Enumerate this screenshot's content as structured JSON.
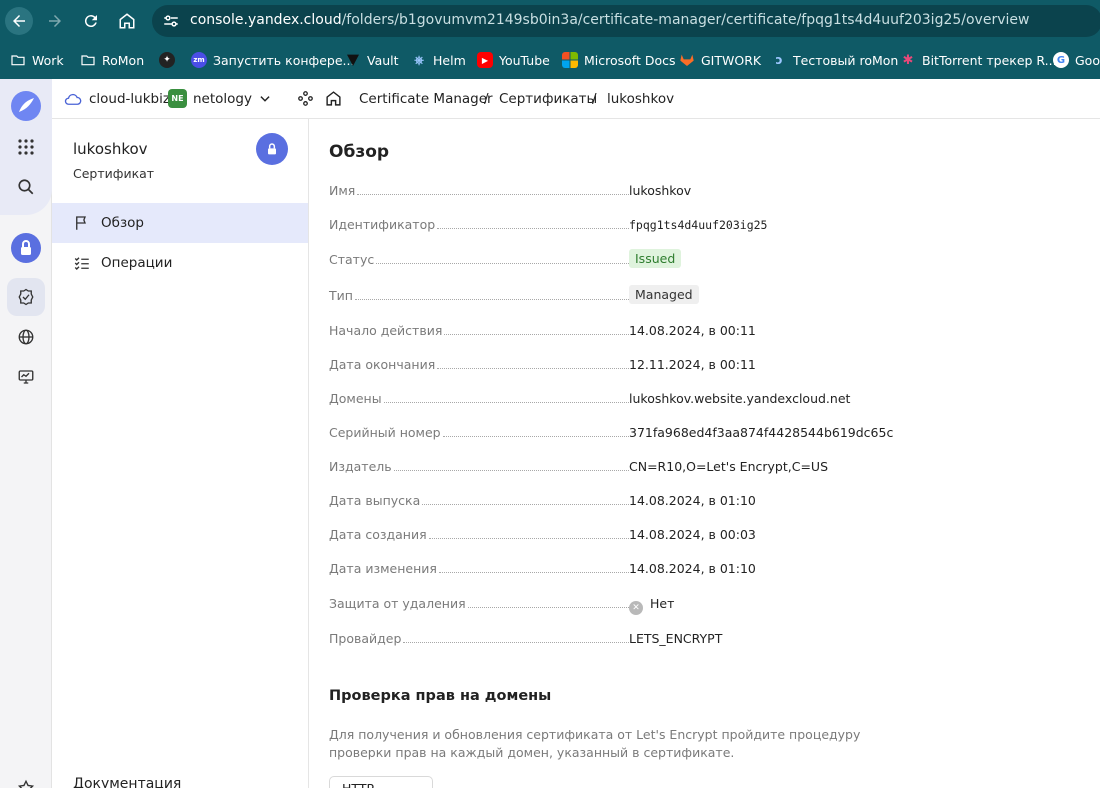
{
  "browser": {
    "url_host": "console.yandex.cloud",
    "url_path": "/folders/b1govumvm2149sb0in3a/certificate-manager/certificate/fpqg1ts4d4uuf203ig25/overview",
    "bookmarks": [
      {
        "label": "Work",
        "icon": "folder-icon"
      },
      {
        "label": "RoMon",
        "icon": "folder-icon"
      },
      {
        "label": "",
        "icon": "plus-star-icon"
      },
      {
        "label": "Запустить конфере...",
        "icon": "zoom-icon"
      },
      {
        "label": "Vault",
        "icon": "vault-icon"
      },
      {
        "label": "Helm",
        "icon": "helm-icon"
      },
      {
        "label": "YouTube",
        "icon": "youtube-icon"
      },
      {
        "label": "Microsoft Docs",
        "icon": "microsoft-icon"
      },
      {
        "label": "GITWORK",
        "icon": "gitlab-icon"
      },
      {
        "label": "Тестовый roMon",
        "icon": "romon-icon"
      },
      {
        "label": "BitTorrent трекер R...",
        "icon": "rutracker-icon"
      },
      {
        "label": "Google",
        "icon": "google-icon"
      }
    ]
  },
  "topbar": {
    "cloud": "cloud-lukbiz",
    "folder_badge": "NE",
    "folder": "netology",
    "breadcrumb": [
      "Certificate Manager",
      "Сертификаты",
      "lukoshkov"
    ],
    "separator": "/"
  },
  "sidebar": {
    "title": "lukoshkov",
    "subtitle": "Сертификат",
    "items": [
      {
        "label": "Обзор",
        "active": true
      },
      {
        "label": "Операции",
        "active": false
      }
    ],
    "docs": "Документация"
  },
  "main": {
    "heading": "Обзор",
    "fields": [
      {
        "label": "Имя",
        "value": "lukoshkov"
      },
      {
        "label": "Идентификатор",
        "value": "fpqg1ts4d4uuf203ig25"
      },
      {
        "label": "Статус",
        "value": "Issued"
      },
      {
        "label": "Тип",
        "value": "Managed"
      },
      {
        "label": "Начало действия",
        "value": "14.08.2024, в 00:11"
      },
      {
        "label": "Дата окончания",
        "value": "12.11.2024, в 00:11"
      },
      {
        "label": "Домены",
        "value": "lukoshkov.website.yandexcloud.net"
      },
      {
        "label": "Серийный номер",
        "value": "371fa968ed4f3aa874f4428544b619dc65c"
      },
      {
        "label": "Издатель",
        "value": "CN=R10,O=Let's Encrypt,C=US"
      },
      {
        "label": "Дата выпуска",
        "value": "14.08.2024, в 01:10"
      },
      {
        "label": "Дата создания",
        "value": "14.08.2024, в 00:03"
      },
      {
        "label": "Дата изменения",
        "value": "14.08.2024, в 01:10"
      },
      {
        "label": "Защита от удаления",
        "value": "Нет"
      },
      {
        "label": "Провайдер",
        "value": "LETS_ENCRYPT"
      }
    ],
    "domains_section_title": "Проверка прав на домены",
    "domains_section_desc": "Для получения и обновления сертификата от Let's Encrypt пройдите процедуру проверки прав на каждый домен, указанный в сертификате.",
    "http_button": "HTTP-запись"
  },
  "colors": {
    "browser_chrome": "#0f5a66",
    "accent": "#5a6fe0",
    "status_issued_bg": "#dff3dd",
    "status_issued_text": "#2e7d2e"
  }
}
